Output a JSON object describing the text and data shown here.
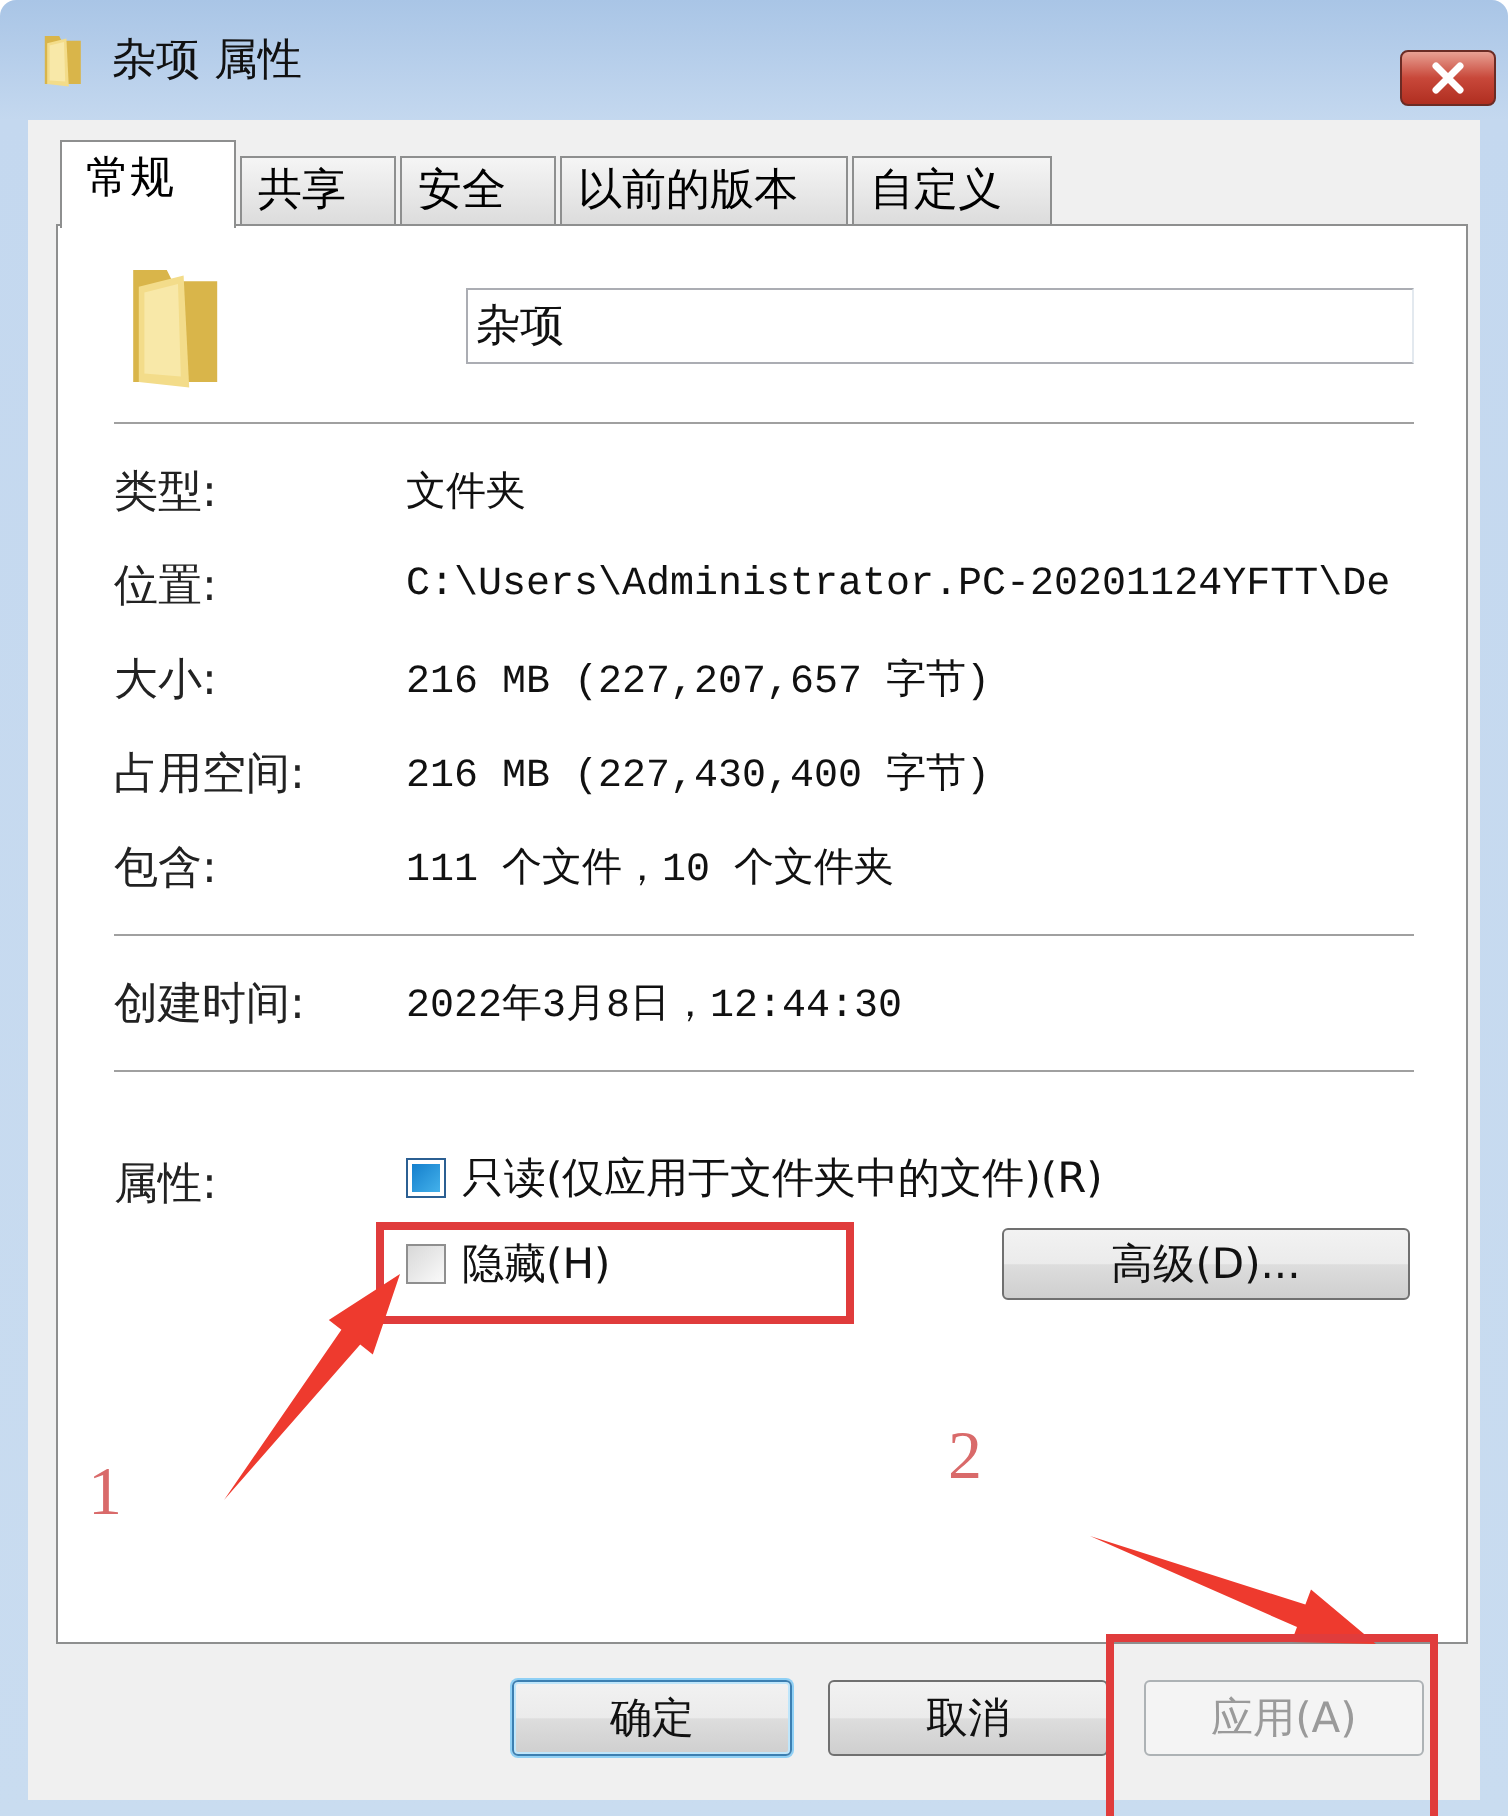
{
  "window": {
    "title": "杂项 属性"
  },
  "tabs": [
    {
      "label": "常规",
      "selected": true
    },
    {
      "label": "共享",
      "selected": false
    },
    {
      "label": "安全",
      "selected": false
    },
    {
      "label": "以前的版本",
      "selected": false
    },
    {
      "label": "自定义",
      "selected": false
    }
  ],
  "name_field": {
    "value": "杂项"
  },
  "sections": [
    {
      "rows": [
        {
          "label": "类型:",
          "value": "文件夹"
        },
        {
          "label": "位置:",
          "value": "C:\\Users\\Administrator.PC-20201124YFTT\\De"
        },
        {
          "label": "大小:",
          "value": "216 MB (227,207,657 字节)"
        },
        {
          "label": "占用空间:",
          "value": "216 MB (227,430,400 字节)"
        },
        {
          "label": "包含:",
          "value": "111 个文件，10 个文件夹"
        }
      ]
    },
    {
      "rows": [
        {
          "label": "创建时间:",
          "value": "2022年3月8日，12:44:30"
        }
      ]
    }
  ],
  "attributes": {
    "label": "属性:",
    "options": [
      {
        "label": "只读(仅应用于文件夹中的文件)(R)",
        "checked": false,
        "indeterminate": true
      },
      {
        "label": "隐藏(H)",
        "checked": false,
        "indeterminate": false
      }
    ],
    "advanced_button": "高级(D)..."
  },
  "buttons": [
    {
      "label": "确定",
      "default": true,
      "disabled": false
    },
    {
      "label": "取消",
      "default": false,
      "disabled": false
    },
    {
      "label": "应用(A)",
      "default": false,
      "disabled": true
    }
  ],
  "annotations": [
    {
      "label": "1"
    },
    {
      "label": "2"
    }
  ]
}
